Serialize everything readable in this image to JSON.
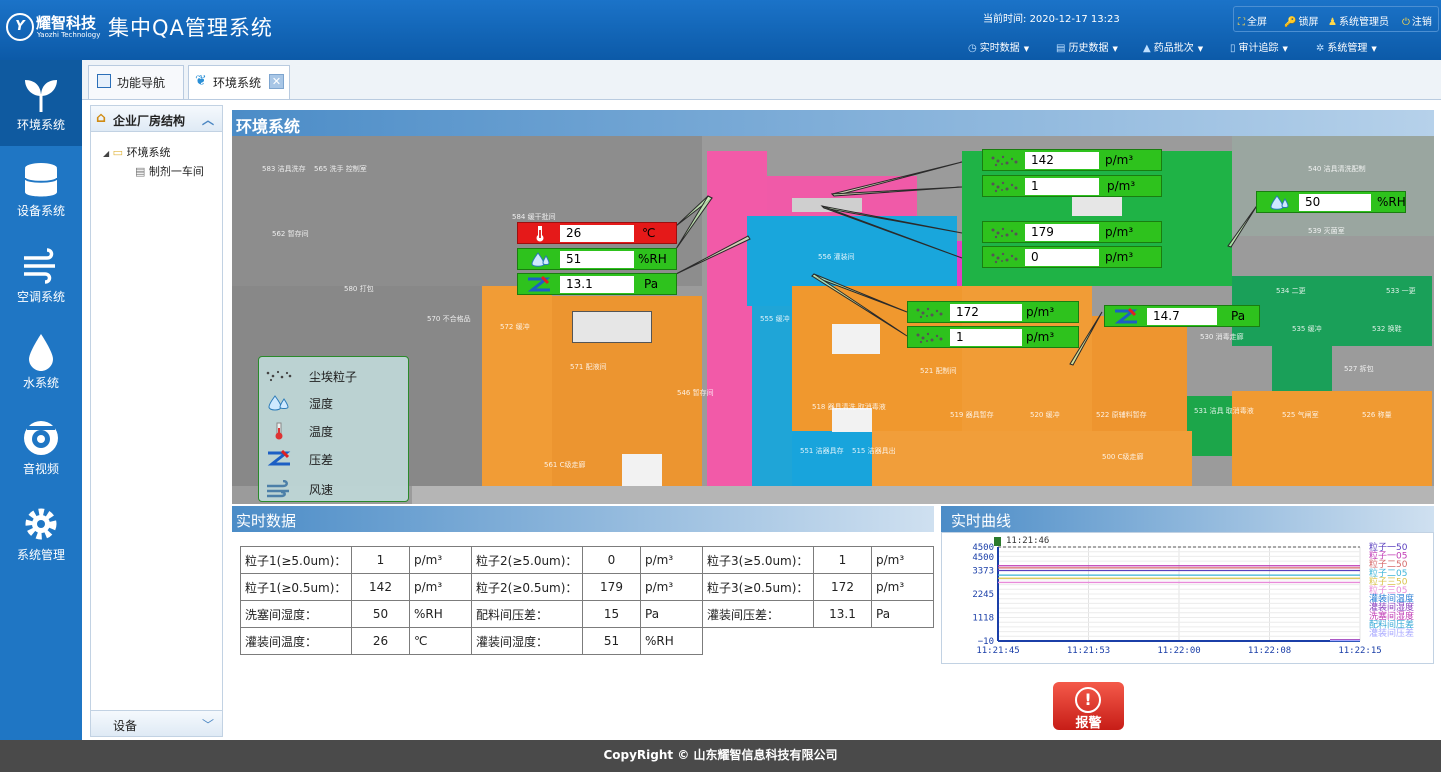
{
  "header": {
    "logo_mark": "Y",
    "company": "耀智科技",
    "company_en": "Yaozhi Technology",
    "title": "集中QA管理系统",
    "datetime_label": "当前时间: ",
    "datetime": "2020-12-17 13:23",
    "tools": [
      {
        "label": "全屏",
        "icon": "fullscreen-icon"
      },
      {
        "label": "锁屏",
        "icon": "key-icon"
      },
      {
        "label": "系统管理员",
        "icon": "user-icon"
      },
      {
        "label": "注销",
        "icon": "logout-icon"
      }
    ],
    "menus": [
      {
        "label": "实时数据",
        "icon": "clock-icon"
      },
      {
        "label": "历史数据",
        "icon": "folder-icon"
      },
      {
        "label": "药品批次",
        "icon": "flask-icon"
      },
      {
        "label": "审计追踪",
        "icon": "document-icon"
      },
      {
        "label": "系统管理",
        "icon": "gears-icon"
      }
    ]
  },
  "sidebar": {
    "items": [
      {
        "label": "环境系统",
        "icon": "sprout-icon"
      },
      {
        "label": "设备系统",
        "icon": "database-icon"
      },
      {
        "label": "空调系统",
        "icon": "wind-icon"
      },
      {
        "label": "水系统",
        "icon": "drop-icon"
      },
      {
        "label": "音视频",
        "icon": "camera-icon"
      },
      {
        "label": "系统管理",
        "icon": "gear-icon"
      }
    ]
  },
  "tabs": [
    {
      "label": "功能导航"
    },
    {
      "label": "环境系统"
    }
  ],
  "tree": {
    "header": "企业厂房结构",
    "root": "环境系统",
    "child": "制剂一车间",
    "footer": "设备"
  },
  "main_title": "环境系统",
  "rooms": {
    "r583": "583 洁具洗存",
    "r565": "565 洗手 控制室",
    "r584": "584 缓干批间",
    "r562": "562 暂存间",
    "r580": "580 打包",
    "r570": "570 不合格品",
    "r572": "572 缓冲",
    "r571": "571 配液间",
    "r546": "546 暂存间",
    "r555": "555 缓冲",
    "r556": "556 灌装间",
    "r521": "521 配制间",
    "r540": "540 洁具清洗配制",
    "r539": "539 灭菌室",
    "r534": "534 二更",
    "r533": "533 一更",
    "r535": "535 缓冲",
    "r532": "532 换鞋",
    "r530": "530 消毒走廊",
    "r527": "527 拆包",
    "r518": "518 器具清洗 取消毒液",
    "r519": "519 器具暂存",
    "r520": "520 缓冲",
    "r522": "522 原辅料暂存",
    "r531": "531 洁具 取消毒液",
    "r525": "525 气闸室",
    "r526": "526 称量",
    "r500": "500 C级走廊",
    "r561": "561 C级走廊",
    "r551": "551 洁器具存",
    "r515": "515 洁器具出"
  },
  "sensors": [
    {
      "kind": "temperature",
      "value": "26",
      "unit": "℃",
      "alarm": true
    },
    {
      "kind": "humidity",
      "value": "51",
      "unit": "%RH",
      "alarm": false
    },
    {
      "kind": "pressure",
      "value": "13.1",
      "unit": "Pa",
      "alarm": false
    },
    {
      "kind": "dust",
      "value": "142",
      "unit": "p/m³",
      "alarm": false
    },
    {
      "kind": "dust",
      "value": "1",
      "unit": "p/m³",
      "alarm": false
    },
    {
      "kind": "dust",
      "value": "179",
      "unit": "p/m³",
      "alarm": false
    },
    {
      "kind": "dust",
      "value": "0",
      "unit": "p/m³",
      "alarm": false
    },
    {
      "kind": "humidity",
      "value": "50",
      "unit": "%RH",
      "alarm": false
    },
    {
      "kind": "dust",
      "value": "172",
      "unit": "p/m³",
      "alarm": false
    },
    {
      "kind": "dust",
      "value": "1",
      "unit": "p/m³",
      "alarm": false
    },
    {
      "kind": "pressure",
      "value": "14.7",
      "unit": "Pa",
      "alarm": false
    }
  ],
  "legend": [
    {
      "label": "尘埃粒子",
      "icon": "dust-icon"
    },
    {
      "label": "湿度",
      "icon": "humidity-icon"
    },
    {
      "label": "温度",
      "icon": "thermometer-icon"
    },
    {
      "label": "压差",
      "icon": "pressure-icon"
    },
    {
      "label": "风速",
      "icon": "wind-speed-icon"
    }
  ],
  "realtime": {
    "title": "实时数据",
    "rows": [
      [
        [
          "粒子1(≥5.0um)：",
          "1",
          "p/m³"
        ],
        [
          "粒子2(≥5.0um)：",
          "0",
          "p/m³"
        ],
        [
          "粒子3(≥5.0um)：",
          "1",
          "p/m³"
        ]
      ],
      [
        [
          "粒子1(≥0.5um)：",
          "142",
          "p/m³"
        ],
        [
          "粒子2(≥0.5um)：",
          "179",
          "p/m³"
        ],
        [
          "粒子3(≥0.5um)：",
          "172",
          "p/m³"
        ]
      ],
      [
        [
          "洗塞间湿度：",
          "50",
          "%RH"
        ],
        [
          "配料间压差：",
          "15",
          "Pa"
        ],
        [
          "灌装间压差：",
          "13.1",
          "Pa"
        ]
      ],
      [
        [
          "灌装间温度：",
          "26",
          "℃"
        ],
        [
          "灌装间湿度：",
          "51",
          "%RH"
        ]
      ]
    ]
  },
  "curve": {
    "title": "实时曲线",
    "cursor_time": "11:21:46",
    "chart_data": {
      "type": "line",
      "yticks": [
        "4500",
        "4500",
        "3373",
        "2245",
        "1118",
        "−10"
      ],
      "xticks": [
        "11:21:45",
        "11:21:53",
        "11:22:00",
        "11:22:08",
        "11:22:15"
      ],
      "ylim": [
        -10,
        4500
      ],
      "series": [
        {
          "name": "粒子一50",
          "color": "#5a3fbf",
          "values": [
            3373,
            3373,
            3373,
            3373,
            3373
          ]
        },
        {
          "name": "粒子一05",
          "color": "#c03ab5",
          "values": [
            3600,
            3600,
            3600,
            3600,
            3600
          ]
        },
        {
          "name": "粒子二50",
          "color": "#d66a6a",
          "values": [
            3500,
            3500,
            3500,
            3500,
            3500
          ]
        },
        {
          "name": "粒子二05",
          "color": "#3fb5d9",
          "values": [
            3150,
            3150,
            3150,
            3150,
            3150
          ]
        },
        {
          "name": "粒子三50",
          "color": "#d9c24a",
          "values": [
            3000,
            3000,
            3000,
            3000,
            3000
          ]
        },
        {
          "name": "粒子三05",
          "color": "#e88bd9",
          "values": [
            2800,
            2800,
            2800,
            2800,
            2800
          ]
        },
        {
          "name": "灌装间温度",
          "color": "#2b7fd6",
          "values": [
            null,
            null,
            null,
            null,
            26
          ]
        },
        {
          "name": "灌装间湿度",
          "color": "#8a3fbf",
          "values": [
            null,
            null,
            null,
            null,
            51
          ]
        },
        {
          "name": "洗塞间湿度",
          "color": "#c03ab5",
          "values": [
            null,
            null,
            null,
            null,
            50
          ]
        },
        {
          "name": "配料间压差",
          "color": "#36a8d6",
          "values": [
            null,
            null,
            null,
            null,
            15
          ]
        },
        {
          "name": "灌装间压差",
          "color": "#a8a8ff",
          "values": [
            null,
            null,
            null,
            null,
            13.1
          ]
        }
      ]
    }
  },
  "alarm_button": {
    "icon_text": "!",
    "label": "报警"
  },
  "footer": "CopyRight © 山东耀智信息科技有限公司"
}
